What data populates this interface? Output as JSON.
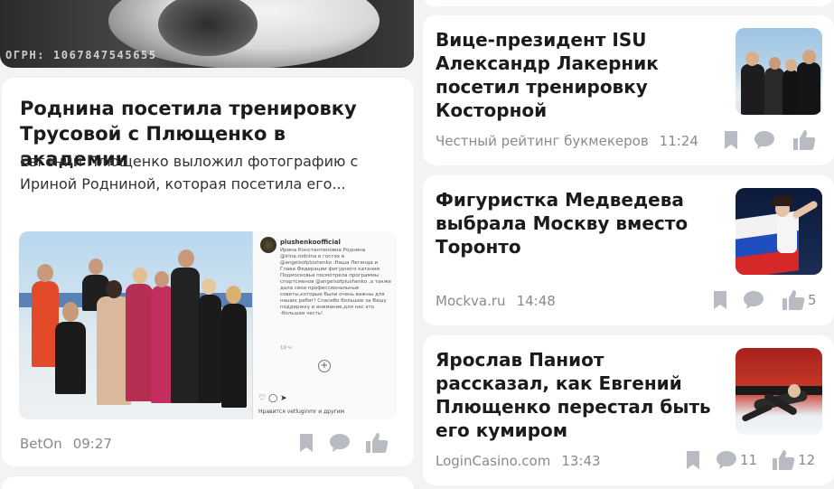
{
  "top_left": {
    "ogrn_text": "ОГРН: 1067847545655"
  },
  "main_article": {
    "title": "Роднина посетила тренировку Трусовой с Плющенко в академии",
    "snippet": "Евгений Плющенко выложил фотографию с Ириной Родниной, которая посетила его...",
    "image": {
      "insta_username": "plushenkoofficial",
      "insta_caption": "Ирина Константиновна Роднина @irina.rodnina в гостях в @angelsofplushenko .Наша Легенда и Глава Федерации фигурного катания Подмосковья посмотрела программы спортсменов @angelsofplushenko ,а также дала свои профессиональные советы,которые были очень важны для наших ребят! Спасибо большое за Вашу поддержку и внимание,для нас это -большая честь!",
      "insta_time": "10 ч.",
      "insta_likes": "Нравится vetluginmr и другим"
    },
    "source": "BetOn",
    "time": "09:27",
    "likes": ""
  },
  "right_articles": [
    {
      "title": "Вице-президент ISU Александр Лакерник посетил тренировку Косторной",
      "source": "Честный рейтинг букмекеров",
      "time": "11:24",
      "comments": "",
      "likes": "",
      "thumb": "isu-photo"
    },
    {
      "title": "Фигуристка Медведева выбрала Москву вместо Торонто",
      "source": "Mockva.ru",
      "time": "14:48",
      "comments": "",
      "likes": "5",
      "thumb": "medvedeva-photo"
    },
    {
      "title": "Ярослав Паниот рассказал, как Евгений Плющенко перестал быть его кумиром",
      "source": "LoginCasino.com",
      "time": "13:43",
      "comments": "11",
      "likes": "12",
      "thumb": "paniot-photo"
    }
  ],
  "icons": {
    "bookmark": "bookmark-icon",
    "comment": "comment-icon",
    "like": "thumbs-up-icon"
  },
  "colors": {
    "icon": "#b8bcc2",
    "meta": "#8a8a8a",
    "card": "#ffffff",
    "background": "#f1f3f5"
  }
}
